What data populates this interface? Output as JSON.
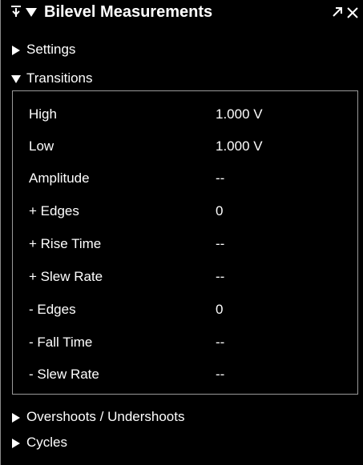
{
  "window": {
    "title": "Bilevel Measurements"
  },
  "icons": {
    "pin": "pin-icon",
    "menu": "triangle-down-icon",
    "undock": "undock-arrow-icon",
    "close": "close-icon"
  },
  "sections": {
    "settings": {
      "label": "Settings",
      "expanded": false
    },
    "transitions": {
      "label": "Transitions",
      "expanded": true
    },
    "overshoots": {
      "label": "Overshoots / Undershoots",
      "expanded": false
    },
    "cycles": {
      "label": "Cycles",
      "expanded": false
    }
  },
  "transitions": {
    "rows": [
      {
        "label": "High",
        "value": "1.000 V"
      },
      {
        "label": "Low",
        "value": "1.000 V"
      },
      {
        "label": "Amplitude",
        "value": "--"
      },
      {
        "label": "+ Edges",
        "value": "0"
      },
      {
        "label": "+ Rise Time",
        "value": "--"
      },
      {
        "label": "+ Slew Rate",
        "value": "--"
      },
      {
        "label": "- Edges",
        "value": "0"
      },
      {
        "label": "- Fall Time",
        "value": "--"
      },
      {
        "label": "- Slew Rate",
        "value": "--"
      }
    ]
  },
  "colors": {
    "background": "#000000",
    "text": "#ffffff",
    "border": "#9a9a9a"
  }
}
